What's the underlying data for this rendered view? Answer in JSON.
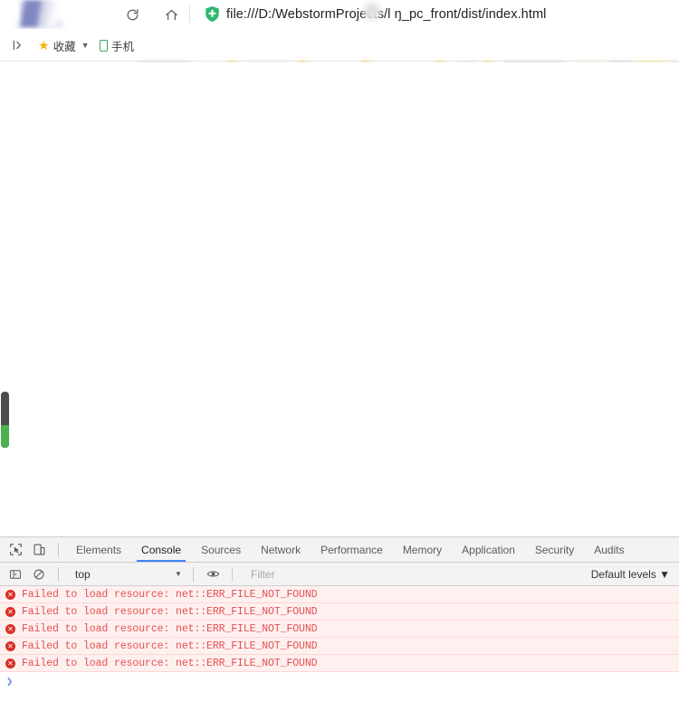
{
  "browser": {
    "reload_icon": "reload-icon",
    "home_icon": "home-icon",
    "extension_icon": "shield-plus-icon",
    "url": "file:///D:/WebstormProjects/l  ŋ_pc_front/dist/index.html",
    "url_prefix": "file:///D:/WebstormProjects/l",
    "url_suffix": "ŋ_pc_front/dist/index.html"
  },
  "bookmarks": {
    "apps_icon": "apps-list-icon",
    "items": [
      {
        "label": "收藏",
        "icon": "star-icon",
        "has_caret": true
      },
      {
        "label": "手机",
        "icon": "phone-icon",
        "has_caret": false
      }
    ],
    "blurred_labels": [
      "ortai",
      "Search t",
      "m+"
    ]
  },
  "page": {
    "meter": {
      "name": "page-meter",
      "track_color": "#4d4d4d",
      "fill_color": "#4caf50",
      "fill_percent": 40
    }
  },
  "devtools": {
    "tool_icons": [
      {
        "name": "inspect-element-icon"
      },
      {
        "name": "device-toolbar-icon"
      }
    ],
    "tabs": [
      {
        "label": "Elements",
        "active": false
      },
      {
        "label": "Console",
        "active": true
      },
      {
        "label": "Sources",
        "active": false
      },
      {
        "label": "Network",
        "active": false
      },
      {
        "label": "Performance",
        "active": false
      },
      {
        "label": "Memory",
        "active": false
      },
      {
        "label": "Application",
        "active": false
      },
      {
        "label": "Security",
        "active": false
      },
      {
        "label": "Audits",
        "active": false
      }
    ],
    "active_tab_indicator_color": "#4285f4",
    "filter_bar": {
      "sidebar_toggle_icon": "console-sidebar-icon",
      "clear_icon": "clear-console-icon",
      "context": "top",
      "context_caret": "▼",
      "eye_icon": "live-expression-icon",
      "filter_placeholder": "Filter",
      "filter_value": "",
      "levels_label": "Default levels ▼"
    },
    "console": {
      "error_icon_glyph": "✕",
      "error_color": "#e45050",
      "error_bg": "#fff0f0",
      "messages": [
        {
          "text": "Failed to load resource: net::ERR_FILE_NOT_FOUND",
          "level": "error"
        },
        {
          "text": "Failed to load resource: net::ERR_FILE_NOT_FOUND",
          "level": "error"
        },
        {
          "text": "Failed to load resource: net::ERR_FILE_NOT_FOUND",
          "level": "error"
        },
        {
          "text": "Failed to load resource: net::ERR_FILE_NOT_FOUND",
          "level": "error"
        },
        {
          "text": "Failed to load resource: net::ERR_FILE_NOT_FOUND",
          "level": "error"
        }
      ],
      "prompt_glyph": "❯"
    }
  }
}
